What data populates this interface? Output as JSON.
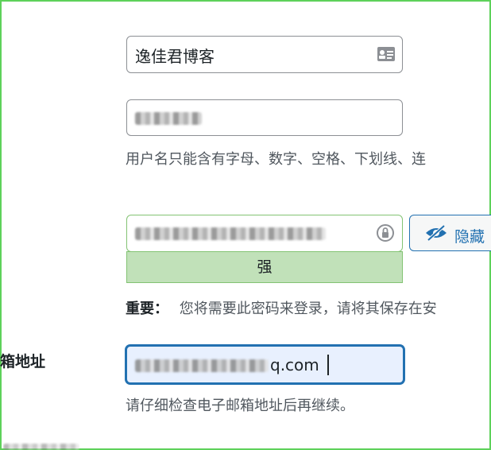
{
  "nickname": {
    "value": "逸佳君博客",
    "icon": "contact-card-icon"
  },
  "username": {
    "description": "用户名只能含有字母、数字、空格、下划线、连"
  },
  "password": {
    "toggle_label": "隐藏",
    "toggle_icon": "eye-slash-icon",
    "field_icon": "lock-icon",
    "strength": "强",
    "strength_color": "#c1e1b9",
    "important_label": "重要：",
    "important_text": "您将需要此密码来登录，请将其保存在安"
  },
  "email": {
    "label": "邮箱地址",
    "visible_value": "q.com",
    "description": "请仔细检查电子邮箱地址后再继续。",
    "focus_color": "#2271b1"
  },
  "colors": {
    "accent": "#2271b1",
    "frame": "#5ed15a"
  }
}
